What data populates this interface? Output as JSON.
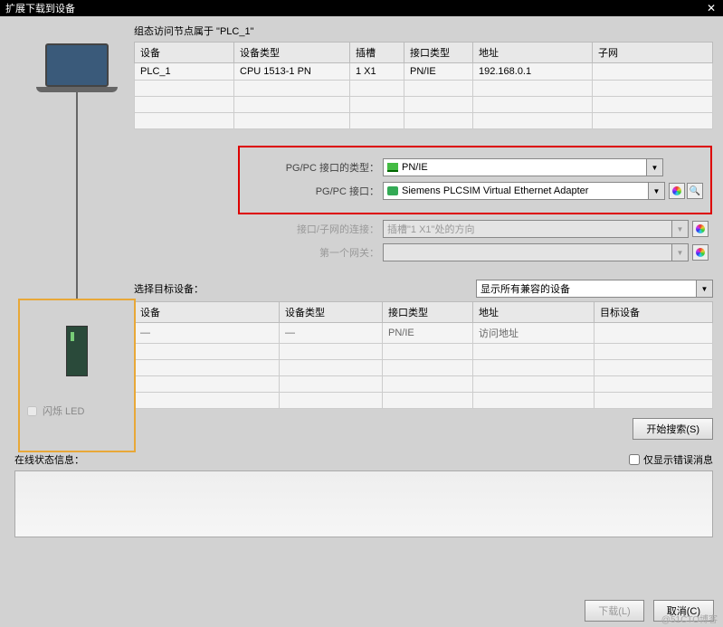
{
  "title": "扩展下载到设备",
  "config_label": "组态访问节点属于 \"PLC_1\"",
  "table1": {
    "headers": [
      "设备",
      "设备类型",
      "插槽",
      "接口类型",
      "地址",
      "子网"
    ],
    "row": {
      "device": "PLC_1",
      "type": "CPU 1513-1 PN",
      "slot": "1 X1",
      "iface": "PN/IE",
      "addr": "192.168.0.1",
      "subnet": ""
    }
  },
  "form": {
    "l_iface_type": "PG/PC 接口的类型：",
    "v_iface_type": "PN/IE",
    "l_iface": "PG/PC 接口：",
    "v_iface": "Siemens PLCSIM Virtual Ethernet Adapter",
    "l_conn": "接口/子网的连接：",
    "v_conn": "插槽\"1 X1\"处的方向",
    "l_gw": "第一个网关：",
    "v_gw": ""
  },
  "target": {
    "label": "选择目标设备：",
    "filter": "显示所有兼容的设备",
    "headers": [
      "设备",
      "设备类型",
      "接口类型",
      "地址",
      "目标设备"
    ],
    "row": {
      "device": "—",
      "type": "—",
      "iface": "PN/IE",
      "addr": "访问地址",
      "target": ""
    }
  },
  "led_label": "闪烁 LED",
  "btn_search": "开始搜索(S)",
  "status_label": "在线状态信息：",
  "err_only": "仅显示错误消息",
  "btn_download": "下载(L)",
  "btn_cancel": "取消(C)",
  "watermark": "@51CTO博客"
}
